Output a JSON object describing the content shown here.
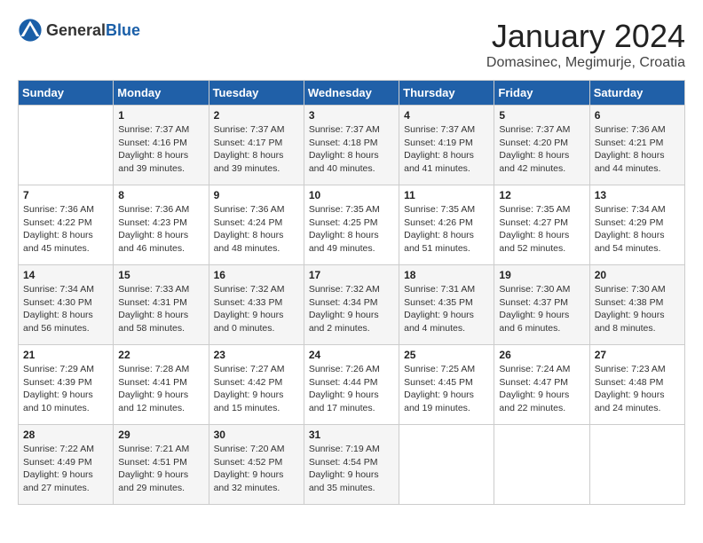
{
  "header": {
    "logo_general": "General",
    "logo_blue": "Blue",
    "month_title": "January 2024",
    "location": "Domasinec, Megimurje, Croatia"
  },
  "weekdays": [
    "Sunday",
    "Monday",
    "Tuesday",
    "Wednesday",
    "Thursday",
    "Friday",
    "Saturday"
  ],
  "weeks": [
    [
      {
        "day": "",
        "info": ""
      },
      {
        "day": "1",
        "info": "Sunrise: 7:37 AM\nSunset: 4:16 PM\nDaylight: 8 hours\nand 39 minutes."
      },
      {
        "day": "2",
        "info": "Sunrise: 7:37 AM\nSunset: 4:17 PM\nDaylight: 8 hours\nand 39 minutes."
      },
      {
        "day": "3",
        "info": "Sunrise: 7:37 AM\nSunset: 4:18 PM\nDaylight: 8 hours\nand 40 minutes."
      },
      {
        "day": "4",
        "info": "Sunrise: 7:37 AM\nSunset: 4:19 PM\nDaylight: 8 hours\nand 41 minutes."
      },
      {
        "day": "5",
        "info": "Sunrise: 7:37 AM\nSunset: 4:20 PM\nDaylight: 8 hours\nand 42 minutes."
      },
      {
        "day": "6",
        "info": "Sunrise: 7:36 AM\nSunset: 4:21 PM\nDaylight: 8 hours\nand 44 minutes."
      }
    ],
    [
      {
        "day": "7",
        "info": "Sunrise: 7:36 AM\nSunset: 4:22 PM\nDaylight: 8 hours\nand 45 minutes."
      },
      {
        "day": "8",
        "info": "Sunrise: 7:36 AM\nSunset: 4:23 PM\nDaylight: 8 hours\nand 46 minutes."
      },
      {
        "day": "9",
        "info": "Sunrise: 7:36 AM\nSunset: 4:24 PM\nDaylight: 8 hours\nand 48 minutes."
      },
      {
        "day": "10",
        "info": "Sunrise: 7:35 AM\nSunset: 4:25 PM\nDaylight: 8 hours\nand 49 minutes."
      },
      {
        "day": "11",
        "info": "Sunrise: 7:35 AM\nSunset: 4:26 PM\nDaylight: 8 hours\nand 51 minutes."
      },
      {
        "day": "12",
        "info": "Sunrise: 7:35 AM\nSunset: 4:27 PM\nDaylight: 8 hours\nand 52 minutes."
      },
      {
        "day": "13",
        "info": "Sunrise: 7:34 AM\nSunset: 4:29 PM\nDaylight: 8 hours\nand 54 minutes."
      }
    ],
    [
      {
        "day": "14",
        "info": "Sunrise: 7:34 AM\nSunset: 4:30 PM\nDaylight: 8 hours\nand 56 minutes."
      },
      {
        "day": "15",
        "info": "Sunrise: 7:33 AM\nSunset: 4:31 PM\nDaylight: 8 hours\nand 58 minutes."
      },
      {
        "day": "16",
        "info": "Sunrise: 7:32 AM\nSunset: 4:33 PM\nDaylight: 9 hours\nand 0 minutes."
      },
      {
        "day": "17",
        "info": "Sunrise: 7:32 AM\nSunset: 4:34 PM\nDaylight: 9 hours\nand 2 minutes."
      },
      {
        "day": "18",
        "info": "Sunrise: 7:31 AM\nSunset: 4:35 PM\nDaylight: 9 hours\nand 4 minutes."
      },
      {
        "day": "19",
        "info": "Sunrise: 7:30 AM\nSunset: 4:37 PM\nDaylight: 9 hours\nand 6 minutes."
      },
      {
        "day": "20",
        "info": "Sunrise: 7:30 AM\nSunset: 4:38 PM\nDaylight: 9 hours\nand 8 minutes."
      }
    ],
    [
      {
        "day": "21",
        "info": "Sunrise: 7:29 AM\nSunset: 4:39 PM\nDaylight: 9 hours\nand 10 minutes."
      },
      {
        "day": "22",
        "info": "Sunrise: 7:28 AM\nSunset: 4:41 PM\nDaylight: 9 hours\nand 12 minutes."
      },
      {
        "day": "23",
        "info": "Sunrise: 7:27 AM\nSunset: 4:42 PM\nDaylight: 9 hours\nand 15 minutes."
      },
      {
        "day": "24",
        "info": "Sunrise: 7:26 AM\nSunset: 4:44 PM\nDaylight: 9 hours\nand 17 minutes."
      },
      {
        "day": "25",
        "info": "Sunrise: 7:25 AM\nSunset: 4:45 PM\nDaylight: 9 hours\nand 19 minutes."
      },
      {
        "day": "26",
        "info": "Sunrise: 7:24 AM\nSunset: 4:47 PM\nDaylight: 9 hours\nand 22 minutes."
      },
      {
        "day": "27",
        "info": "Sunrise: 7:23 AM\nSunset: 4:48 PM\nDaylight: 9 hours\nand 24 minutes."
      }
    ],
    [
      {
        "day": "28",
        "info": "Sunrise: 7:22 AM\nSunset: 4:49 PM\nDaylight: 9 hours\nand 27 minutes."
      },
      {
        "day": "29",
        "info": "Sunrise: 7:21 AM\nSunset: 4:51 PM\nDaylight: 9 hours\nand 29 minutes."
      },
      {
        "day": "30",
        "info": "Sunrise: 7:20 AM\nSunset: 4:52 PM\nDaylight: 9 hours\nand 32 minutes."
      },
      {
        "day": "31",
        "info": "Sunrise: 7:19 AM\nSunset: 4:54 PM\nDaylight: 9 hours\nand 35 minutes."
      },
      {
        "day": "",
        "info": ""
      },
      {
        "day": "",
        "info": ""
      },
      {
        "day": "",
        "info": ""
      }
    ]
  ]
}
